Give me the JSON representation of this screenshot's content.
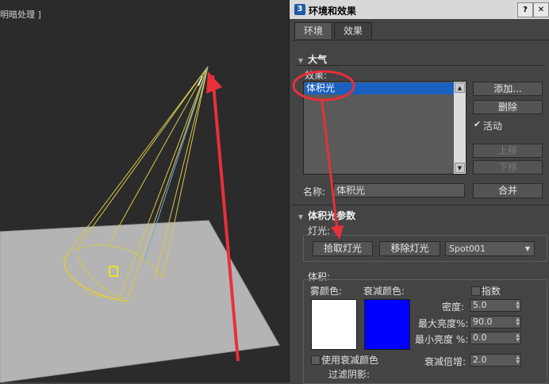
{
  "viewport": {
    "label": "明暗处理 ]"
  },
  "window": {
    "title": "环境和效果",
    "icon_char": "3",
    "controls": [
      "?",
      "✕"
    ]
  },
  "tabs": [
    {
      "label": "环境",
      "active": true
    },
    {
      "label": "效果",
      "active": false
    }
  ],
  "atmosphere": {
    "header": "大气",
    "effects_label": "效果:",
    "effects_list": [
      "体积光"
    ],
    "add_button": "添加...",
    "delete_button": "删除",
    "active_checkbox": {
      "label": "活动",
      "checked": true
    },
    "move_up_button": "上移",
    "move_down_button": "下移",
    "name_label": "名称:",
    "name_value": "体积光",
    "merge_button": "合并"
  },
  "volume_light": {
    "header": "体积光参数",
    "lights_label": "灯光:",
    "pick_light_button": "拾取灯光",
    "remove_light_button": "移除灯光",
    "light_dropdown": "Spot001",
    "volume_label": "体积:",
    "fog_color_label": "雾颜色:",
    "attenuation_color_label": "衰减颜色:",
    "fog_color": "#ffffff",
    "attenuation_color": "#0000ff",
    "exponential": {
      "label": "指数",
      "checked": false
    },
    "density": {
      "label": "密度:",
      "value": "5.0"
    },
    "max_brightness": {
      "label": "最大亮度%:",
      "value": "90.0"
    },
    "min_brightness": {
      "label": "最小亮度 %:",
      "value": "0.0"
    },
    "use_attenuation_color": {
      "label": "使用衰减颜色",
      "checked": false
    },
    "attenuation_multiplier": {
      "label": "衰减倍增:",
      "value": "2.0"
    },
    "filter_shadows_label": "过滤阴影:"
  },
  "colors": {
    "annotation": "#e8303a",
    "selection": "#1b5fbf",
    "panel_bg": "#444444",
    "viewport_bg": "#2b2b2b",
    "light_cone": "#d8c84a",
    "ground_plane": "#b4b4b4"
  }
}
